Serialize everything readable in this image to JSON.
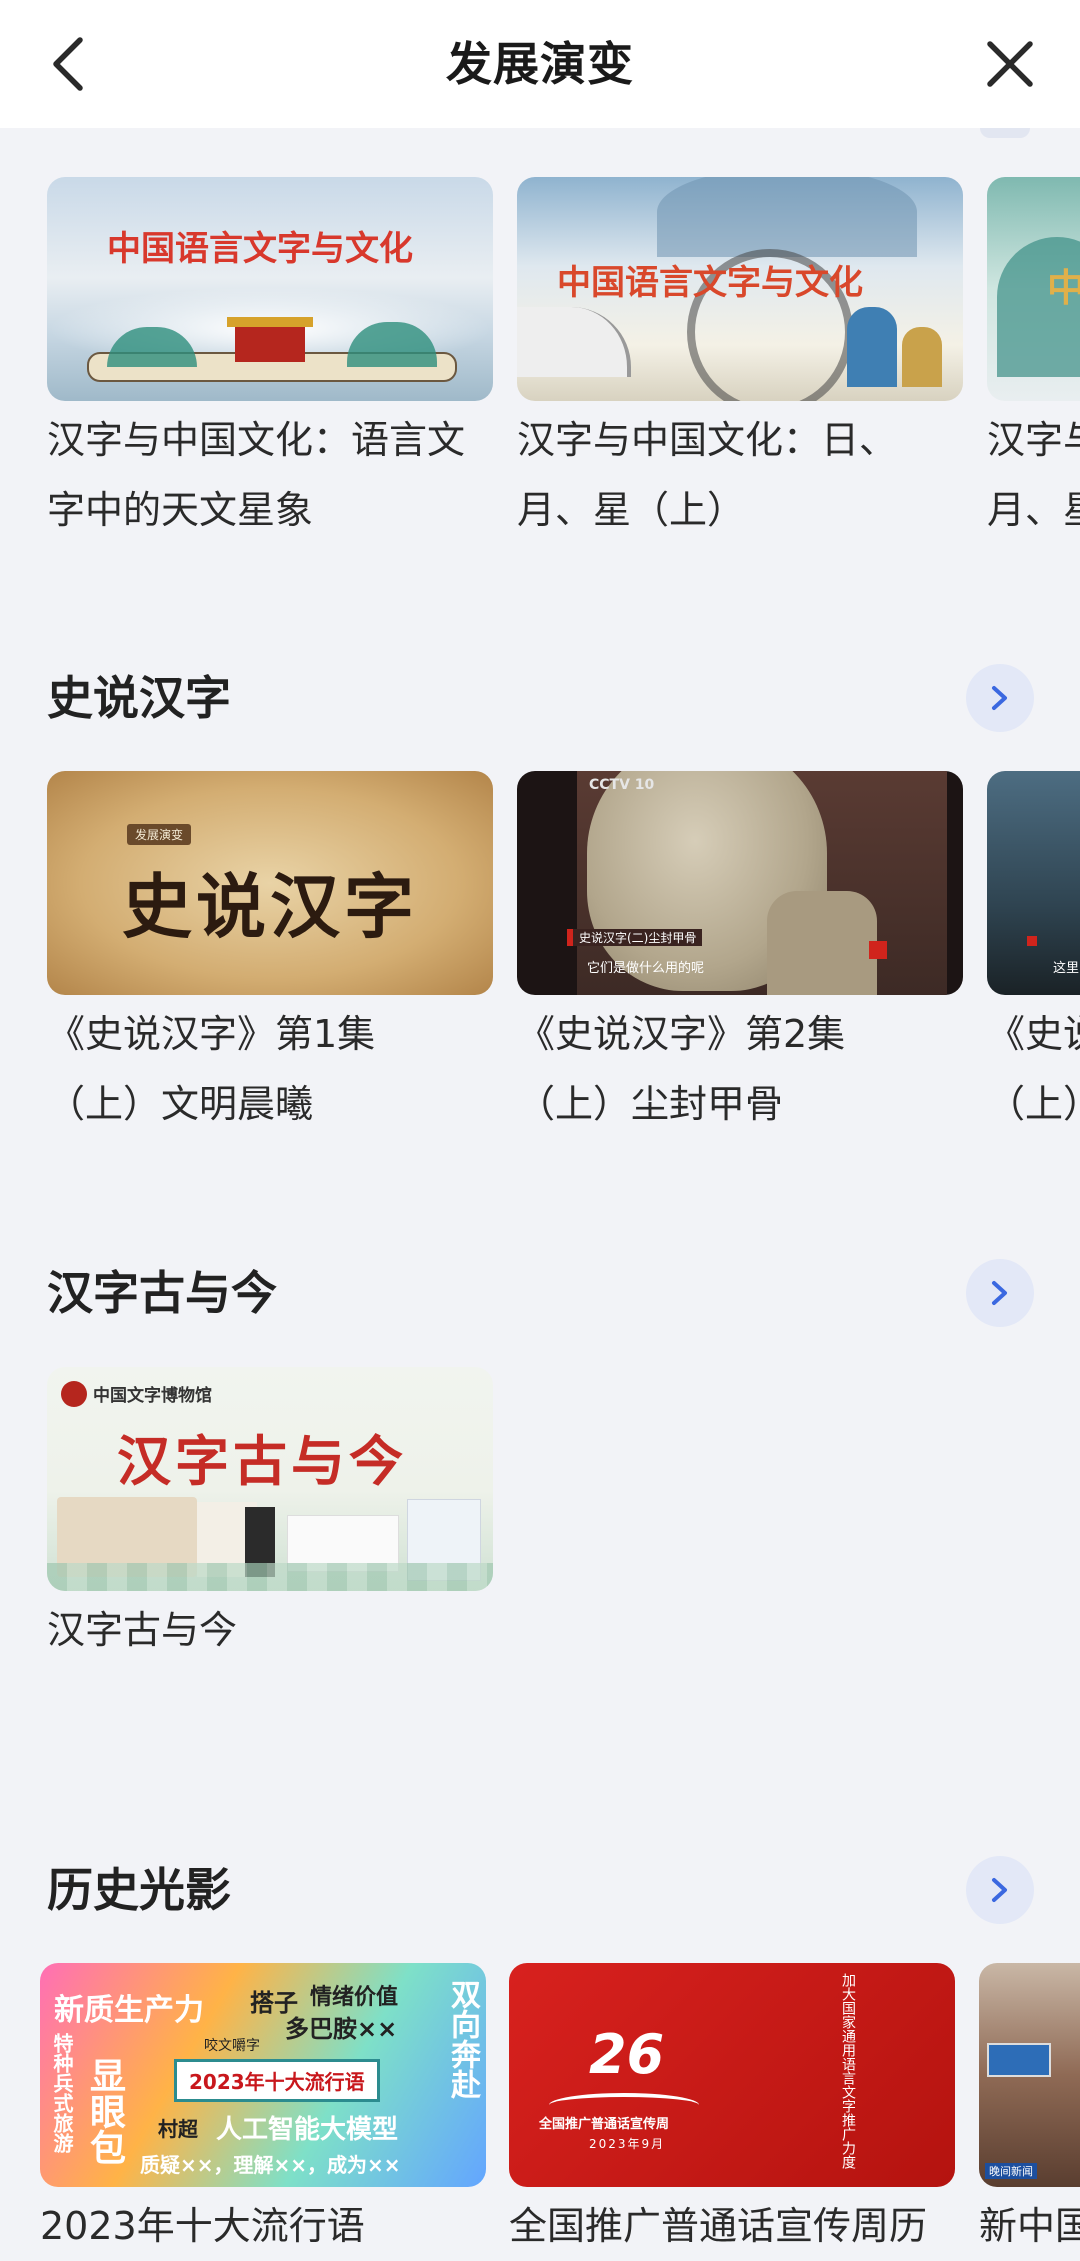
{
  "header": {
    "title": "发展演变"
  },
  "sections": [
    {
      "cards": [
        {
          "title": "汉字与中国文化：语言文字中的天文星象",
          "thumb": "中国语言文字与文化"
        },
        {
          "title": "汉字与中国文化：日、月、星（上）",
          "thumb": "中国语言文字与文化"
        },
        {
          "title": "汉字与中国文化：日、月、星",
          "thumb": "中"
        }
      ]
    },
    {
      "title": "史说汉字",
      "cards": [
        {
          "title": "《史说汉字》第1集\n（上）文明晨曦",
          "thumb": "史说汉字",
          "badge": "发展演变"
        },
        {
          "title": "《史说汉字》第2集\n（上）尘封甲骨",
          "thumb_logo": "CCTV 10",
          "caption_top": "史说汉字(二)尘封甲骨",
          "caption_bottom": "它们是做什么用的呢"
        },
        {
          "title": "《史说汉字》\n（上）",
          "caption_bottom": "这里"
        }
      ]
    },
    {
      "title": "汉字古与今",
      "cards": [
        {
          "title": "汉字古与今",
          "thumb": "汉字古与今",
          "museum": "中国文字博物馆"
        }
      ]
    },
    {
      "title": "历史光影",
      "cards": [
        {
          "title": "2023年十大流行语",
          "banner": "2023年十大流行语",
          "tag": "咬文嚼字",
          "words": [
            "新质生产力",
            "搭子",
            "情绪价值",
            "多巴胺××",
            "双向奔赴",
            "特种兵式旅游",
            "显眼包",
            "村超",
            "人工智能大模型",
            "质疑××，理解××，成为××"
          ]
        },
        {
          "title": "全国推广普通话宣传周历",
          "number": "26",
          "subtitle": "全国推广普通话宣传周",
          "date": "2023年9月",
          "vertical": "加大国家通用语言文字推广力度"
        },
        {
          "title": "新中国",
          "logo": "晚间新闻"
        }
      ]
    }
  ]
}
